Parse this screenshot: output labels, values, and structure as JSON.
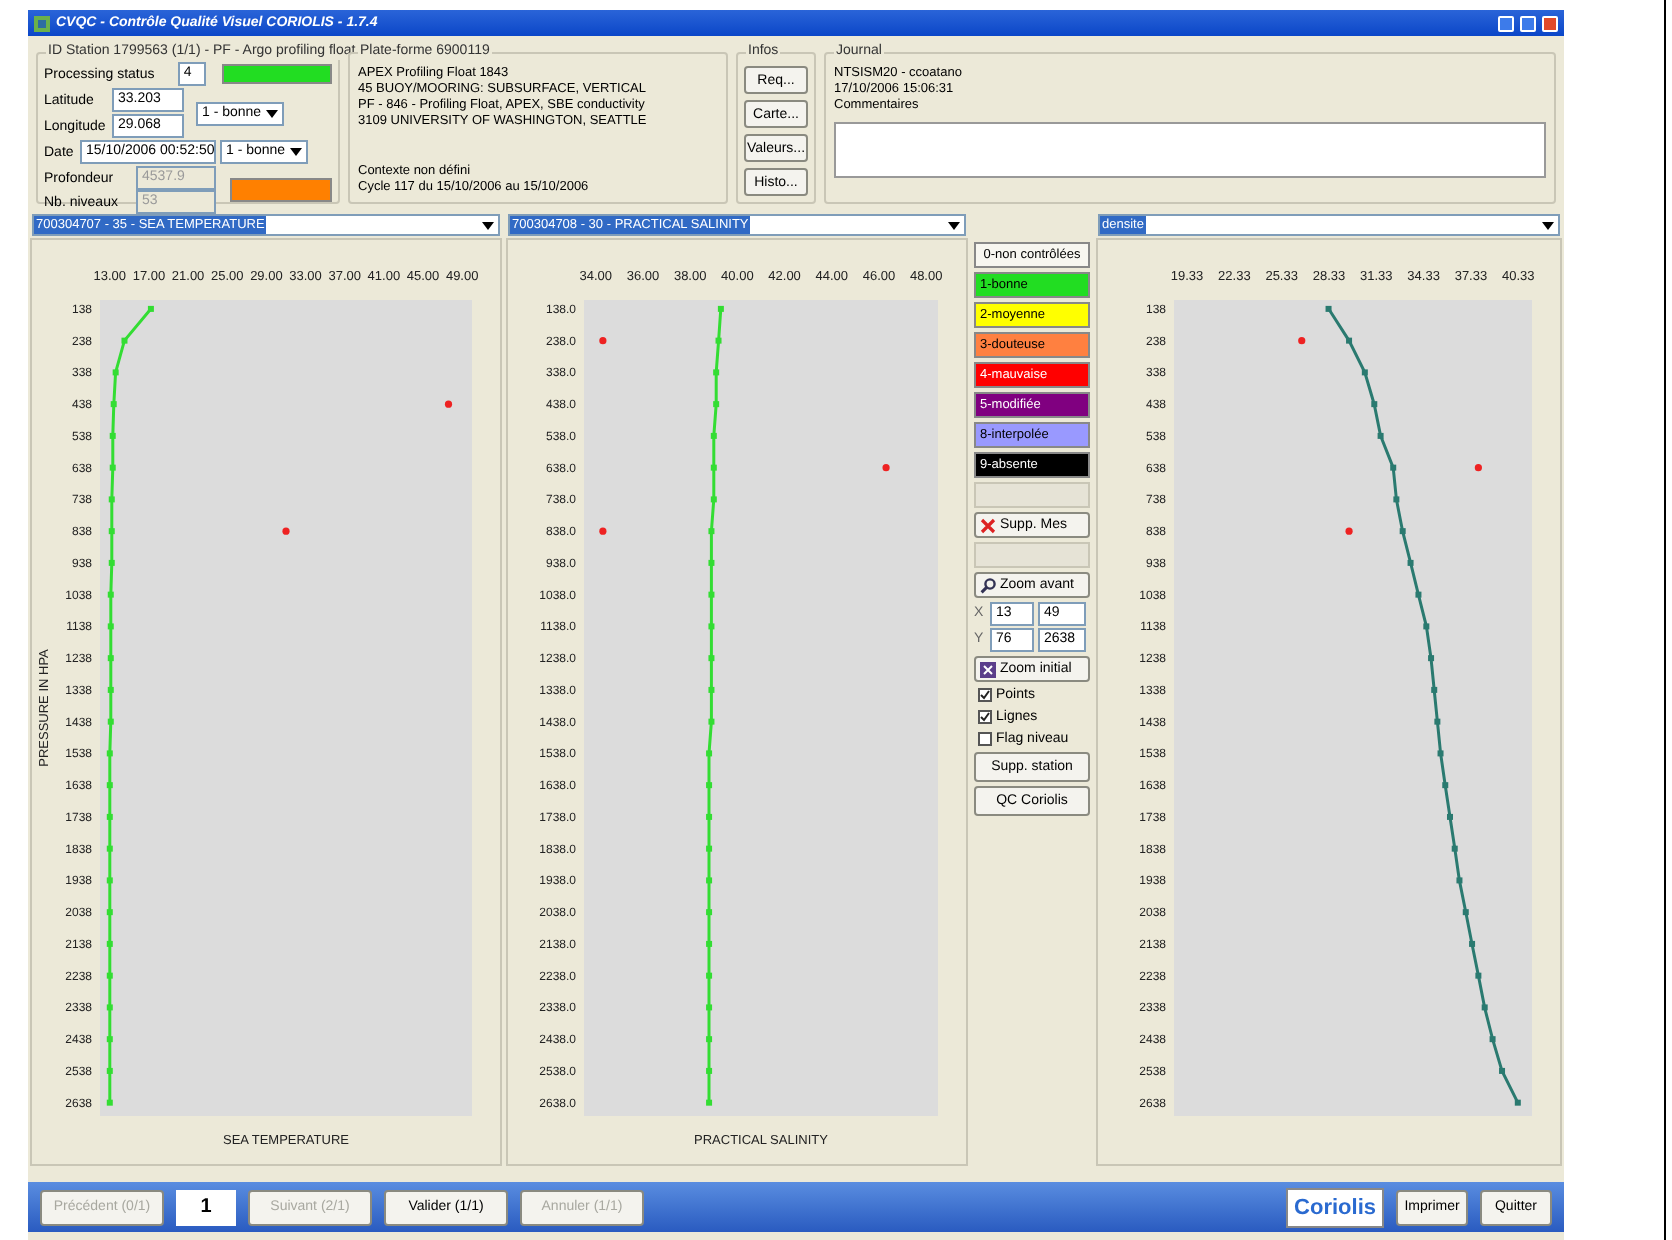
{
  "window": {
    "title": "CVQC - Contrôle Qualité Visuel CORIOLIS - 1.7.4"
  },
  "station": {
    "title": "ID Station 1799563 (1/1) - PF - Argo profiling float",
    "status": {
      "label": "Processing status",
      "value": "4",
      "color": "#22dd22"
    },
    "latitude": {
      "label": "Latitude",
      "value": "33.203"
    },
    "longitude": {
      "label": "Longitude",
      "value": "29.068"
    },
    "position_flag": "1 - bonne",
    "date": {
      "label": "Date",
      "value": "15/10/2006 00:52:50"
    },
    "date_flag": "1 - bonne",
    "depth": {
      "label": "Profondeur",
      "value": "4537.9",
      "disabled": true,
      "color": "#ff8000"
    },
    "levels": {
      "label": "Nb. niveaux",
      "value": "53",
      "disabled": true
    }
  },
  "platform": {
    "title": "Plate-forme 6900119",
    "lines": [
      "APEX Profiling Float 1843",
      "45 BUOY/MOORING: SUBSURFACE, VERTICAL",
      "PF - 846 - Profiling Float, APEX, SBE conductivity",
      "3109 UNIVERSITY OF WASHINGTON, SEATTLE"
    ],
    "context": [
      "Contexte non défini",
      "Cycle 117 du 15/10/2006 au 15/10/2006"
    ]
  },
  "infos": {
    "title": "Infos",
    "buttons": [
      "Req...",
      "Carte...",
      "Valeurs...",
      "Histo..."
    ]
  },
  "journal": {
    "title": "Journal",
    "lines": [
      "NTSISM20 - ccoatano",
      "17/10/2006 15:06:31",
      "Commentaires"
    ]
  },
  "parameters": [
    "700304707 - 35 - SEA TEMPERATURE",
    "700304708 - 30 - PRACTICAL SALINITY",
    "densite"
  ],
  "charts": [
    {
      "chart_data": {
        "type": "line",
        "orientation": "horizontal",
        "xlabel": "SEA TEMPERATURE",
        "ylabel": "PRESSURE IN HPA",
        "x": [
          138,
          238,
          338,
          438,
          538,
          638,
          738,
          838,
          938,
          1038,
          1138,
          1238,
          1338,
          1438,
          1538,
          1638,
          1738,
          1838,
          1938,
          2038,
          2138,
          2238,
          2338,
          2438,
          2538,
          2638
        ],
        "xticks": [
          {
            "value": 13,
            "label": "13.00"
          },
          {
            "value": 17,
            "label": "17.00"
          },
          {
            "value": 21,
            "label": "21.00"
          },
          {
            "value": 25,
            "label": "25.00"
          },
          {
            "value": 29,
            "label": "29.00"
          },
          {
            "value": 33,
            "label": "33.00"
          },
          {
            "value": 37,
            "label": "37.00"
          },
          {
            "value": 41,
            "label": "41.00"
          },
          {
            "value": 45,
            "label": "45.00"
          },
          {
            "value": 49,
            "label": "49.00"
          }
        ],
        "xlim": [
          12,
          50
        ],
        "ylim": [
          2680,
          110
        ],
        "yticks": [
          {
            "value": 138,
            "label": "138"
          },
          {
            "value": 238,
            "label": "238"
          },
          {
            "value": 338,
            "label": "338"
          },
          {
            "value": 438,
            "label": "438"
          },
          {
            "value": 538,
            "label": "538"
          },
          {
            "value": 638,
            "label": "638"
          },
          {
            "value": 738,
            "label": "738"
          },
          {
            "value": 838,
            "label": "838"
          },
          {
            "value": 938,
            "label": "938"
          },
          {
            "value": 1038,
            "label": "1038"
          },
          {
            "value": 1138,
            "label": "1138"
          },
          {
            "value": 1238,
            "label": "1238"
          },
          {
            "value": 1338,
            "label": "1338"
          },
          {
            "value": 1438,
            "label": "1438"
          },
          {
            "value": 1538,
            "label": "1538"
          },
          {
            "value": 1638,
            "label": "1638"
          },
          {
            "value": 1738,
            "label": "1738"
          },
          {
            "value": 1838,
            "label": "1838"
          },
          {
            "value": 1938,
            "label": "1938"
          },
          {
            "value": 2038,
            "label": "2038"
          },
          {
            "value": 2138,
            "label": "2138"
          },
          {
            "value": 2238,
            "label": "2238"
          },
          {
            "value": 2338,
            "label": "2338"
          },
          {
            "value": 2438,
            "label": "2438"
          },
          {
            "value": 2538,
            "label": "2538"
          },
          {
            "value": 2638,
            "label": "2638"
          }
        ],
        "series": [
          {
            "type": "line",
            "marker": "square",
            "color": "#33dd33",
            "values": [
              17.2,
              14.5,
              13.6,
              13.4,
              13.3,
              13.3,
              13.2,
              13.2,
              13.2,
              13.1,
              13.1,
              13.1,
              13.1,
              13.1,
              13.0,
              13.0,
              13.0,
              13.0,
              13.0,
              13.0,
              13.0,
              13.0,
              13.0,
              13.0,
              13.0,
              13.0
            ]
          },
          {
            "type": "scatter",
            "color": "#ee2222",
            "values": [
              null,
              null,
              null,
              47.6,
              null,
              null,
              null,
              31,
              null,
              null,
              null,
              null,
              null,
              null,
              null,
              null,
              null,
              null,
              null,
              null,
              null,
              null,
              null,
              null,
              null,
              null
            ]
          }
        ]
      }
    },
    {
      "chart_data": {
        "type": "line",
        "orientation": "horizontal",
        "xlabel": "PRACTICAL SALINITY",
        "x": [
          138,
          238,
          338,
          438,
          538,
          638,
          738,
          838,
          938,
          1038,
          1138,
          1238,
          1338,
          1438,
          1538,
          1638,
          1738,
          1838,
          1938,
          2038,
          2138,
          2238,
          2338,
          2438,
          2538,
          2638
        ],
        "xticks": [
          {
            "value": 34,
            "label": "34.00"
          },
          {
            "value": 36,
            "label": "36.00"
          },
          {
            "value": 38,
            "label": "38.00"
          },
          {
            "value": 40,
            "label": "40.00"
          },
          {
            "value": 42,
            "label": "42.00"
          },
          {
            "value": 44,
            "label": "44.00"
          },
          {
            "value": 46,
            "label": "46.00"
          },
          {
            "value": 48,
            "label": "48.00"
          }
        ],
        "xlim": [
          33.5,
          48.5
        ],
        "ylim": [
          2680,
          110
        ],
        "yticks": [
          {
            "value": 138,
            "label": "138.0"
          },
          {
            "value": 238,
            "label": "238.0"
          },
          {
            "value": 338,
            "label": "338.0"
          },
          {
            "value": 438,
            "label": "438.0"
          },
          {
            "value": 538,
            "label": "538.0"
          },
          {
            "value": 638,
            "label": "638.0"
          },
          {
            "value": 738,
            "label": "738.0"
          },
          {
            "value": 838,
            "label": "838.0"
          },
          {
            "value": 938,
            "label": "938.0"
          },
          {
            "value": 1038,
            "label": "1038.0"
          },
          {
            "value": 1138,
            "label": "1138.0"
          },
          {
            "value": 1238,
            "label": "1238.0"
          },
          {
            "value": 1338,
            "label": "1338.0"
          },
          {
            "value": 1438,
            "label": "1438.0"
          },
          {
            "value": 1538,
            "label": "1538.0"
          },
          {
            "value": 1638,
            "label": "1638.0"
          },
          {
            "value": 1738,
            "label": "1738.0"
          },
          {
            "value": 1838,
            "label": "1838.0"
          },
          {
            "value": 1938,
            "label": "1938.0"
          },
          {
            "value": 2038,
            "label": "2038.0"
          },
          {
            "value": 2138,
            "label": "2138.0"
          },
          {
            "value": 2238,
            "label": "2238.0"
          },
          {
            "value": 2338,
            "label": "2338.0"
          },
          {
            "value": 2438,
            "label": "2438.0"
          },
          {
            "value": 2538,
            "label": "2538.0"
          },
          {
            "value": 2638,
            "label": "2638.0"
          }
        ],
        "series": [
          {
            "type": "line",
            "marker": "square",
            "color": "#33dd33",
            "values": [
              39.3,
              39.2,
              39.1,
              39.1,
              39.0,
              39.0,
              39.0,
              38.9,
              38.9,
              38.9,
              38.9,
              38.9,
              38.9,
              38.9,
              38.8,
              38.8,
              38.8,
              38.8,
              38.8,
              38.8,
              38.8,
              38.8,
              38.8,
              38.8,
              38.8,
              38.8
            ]
          },
          {
            "type": "scatter",
            "color": "#ee2222",
            "values": [
              null,
              34.3,
              null,
              null,
              null,
              46.3,
              null,
              34.3,
              null,
              null,
              null,
              null,
              null,
              null,
              null,
              null,
              null,
              null,
              null,
              null,
              null,
              null,
              null,
              null,
              null,
              null
            ]
          }
        ]
      }
    },
    {
      "chart_data": {
        "type": "line",
        "orientation": "horizontal",
        "x": [
          138,
          238,
          338,
          438,
          538,
          638,
          738,
          838,
          938,
          1038,
          1138,
          1238,
          1338,
          1438,
          1538,
          1638,
          1738,
          1838,
          1938,
          2038,
          2138,
          2238,
          2338,
          2438,
          2538,
          2638
        ],
        "xticks": [
          {
            "value": 19.33,
            "label": "19.33"
          },
          {
            "value": 22.33,
            "label": "22.33"
          },
          {
            "value": 25.33,
            "label": "25.33"
          },
          {
            "value": 28.33,
            "label": "28.33"
          },
          {
            "value": 31.33,
            "label": "31.33"
          },
          {
            "value": 34.33,
            "label": "34.33"
          },
          {
            "value": 37.33,
            "label": "37.33"
          },
          {
            "value": 40.33,
            "label": "40.33"
          }
        ],
        "xlim": [
          18.5,
          41.2
        ],
        "ylim": [
          2680,
          110
        ],
        "yticks": [
          {
            "value": 138,
            "label": "138"
          },
          {
            "value": 238,
            "label": "238"
          },
          {
            "value": 338,
            "label": "338"
          },
          {
            "value": 438,
            "label": "438"
          },
          {
            "value": 538,
            "label": "538"
          },
          {
            "value": 638,
            "label": "638"
          },
          {
            "value": 738,
            "label": "738"
          },
          {
            "value": 838,
            "label": "838"
          },
          {
            "value": 938,
            "label": "938"
          },
          {
            "value": 1038,
            "label": "1038"
          },
          {
            "value": 1138,
            "label": "1138"
          },
          {
            "value": 1238,
            "label": "1238"
          },
          {
            "value": 1338,
            "label": "1338"
          },
          {
            "value": 1438,
            "label": "1438"
          },
          {
            "value": 1538,
            "label": "1538"
          },
          {
            "value": 1638,
            "label": "1638"
          },
          {
            "value": 1738,
            "label": "1738"
          },
          {
            "value": 1838,
            "label": "1838"
          },
          {
            "value": 1938,
            "label": "1938"
          },
          {
            "value": 2038,
            "label": "2038"
          },
          {
            "value": 2138,
            "label": "2138"
          },
          {
            "value": 2238,
            "label": "2238"
          },
          {
            "value": 2338,
            "label": "2338"
          },
          {
            "value": 2438,
            "label": "2438"
          },
          {
            "value": 2538,
            "label": "2538"
          },
          {
            "value": 2638,
            "label": "2638"
          }
        ],
        "series": [
          {
            "type": "line",
            "marker": "square",
            "color": "#2a7a70",
            "values": [
              28.3,
              29.6,
              30.6,
              31.2,
              31.6,
              32.4,
              32.6,
              33.0,
              33.5,
              34.0,
              34.5,
              34.8,
              35.0,
              35.2,
              35.4,
              35.7,
              36.0,
              36.3,
              36.6,
              37.0,
              37.4,
              37.8,
              38.2,
              38.7,
              39.3,
              40.3
            ]
          },
          {
            "type": "scatter",
            "color": "#ee2222",
            "values": [
              null,
              26.6,
              null,
              null,
              null,
              37.8,
              null,
              29.6,
              null,
              null,
              null,
              null,
              null,
              null,
              null,
              null,
              null,
              null,
              null,
              null,
              null,
              null,
              null,
              null,
              null,
              null
            ]
          }
        ]
      }
    }
  ],
  "flags": [
    {
      "label": "0-non contrôlées",
      "color": "#f7f6f0"
    },
    {
      "label": "1-bonne",
      "color": "#22dd22"
    },
    {
      "label": "2-moyenne",
      "color": "#ffff00"
    },
    {
      "label": "3-douteuse",
      "color": "#ff8040"
    },
    {
      "label": "4-mauvaise",
      "color": "#ff0000"
    },
    {
      "label": "5-modifiée",
      "color": "#800080"
    },
    {
      "label": "8-interpolée",
      "color": "#9999ff"
    },
    {
      "label": "9-absente",
      "color": "#000000"
    }
  ],
  "tools": [
    {
      "kind": "blank"
    },
    {
      "kind": "delete",
      "label": "Supp. Mes"
    },
    {
      "kind": "blank"
    },
    {
      "kind": "zoom",
      "label": "Zoom avant"
    },
    {
      "kind": "coords",
      "rows": [
        {
          "label": "X",
          "from": "13",
          "to": "49"
        },
        {
          "label": "Y",
          "from": "76",
          "to": "2638"
        }
      ]
    },
    {
      "kind": "reset",
      "label": "Zoom initial"
    },
    {
      "kind": "checkbox",
      "label": "Points",
      "checked": true
    },
    {
      "kind": "checkbox",
      "label": "Lignes",
      "checked": true
    },
    {
      "kind": "checkbox",
      "label": "Flag niveau",
      "checked": false
    },
    {
      "kind": "plain",
      "label": "Supp. station"
    },
    {
      "kind": "plain",
      "label": "QC Coriolis"
    }
  ],
  "footer": {
    "buttons": [
      {
        "label": "Précédent (0/1)",
        "disabled": true
      },
      {
        "kind": "page",
        "label": "1"
      },
      {
        "label": "Suivant (2/1)",
        "disabled": true
      },
      {
        "label": "Valider (1/1)",
        "disabled": false
      },
      {
        "label": "Annuler (1/1)",
        "disabled": true
      }
    ],
    "logo": "Coriolis",
    "actions": [
      "Imprimer",
      "Quitter"
    ]
  }
}
